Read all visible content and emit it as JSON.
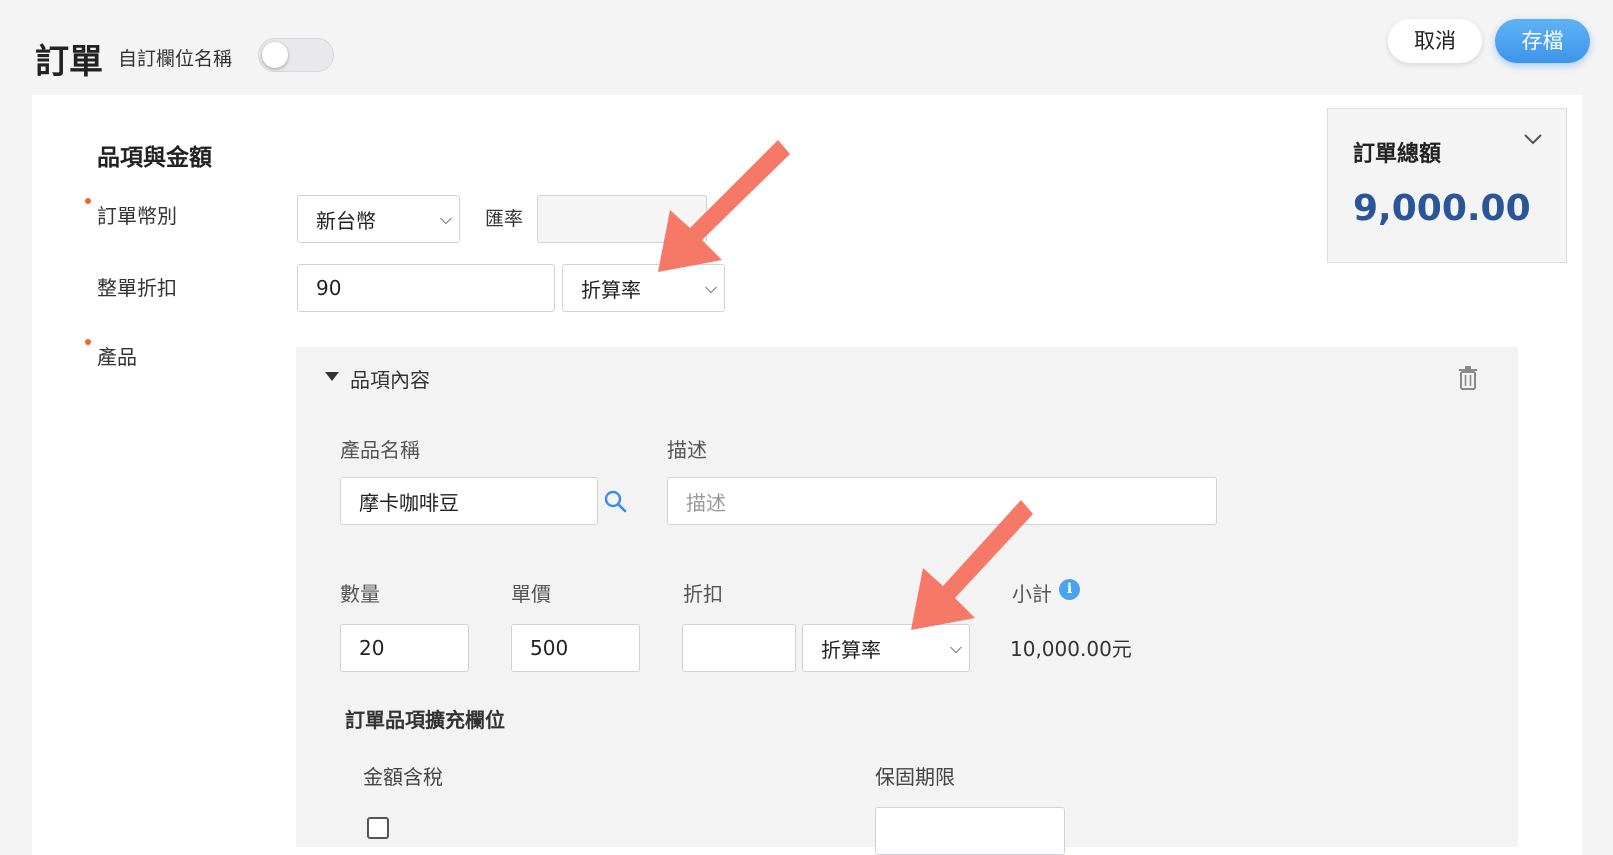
{
  "header": {
    "title": "訂單",
    "custom_label": "自訂欄位名稱",
    "toggle_on": false,
    "cancel_label": "取消",
    "save_label": "存檔"
  },
  "section": {
    "title": "品項與金額",
    "currency_label": "訂單幣別",
    "currency_value": "新台幣",
    "rate_label": "匯率",
    "rate_value": "",
    "discount_label": "整單折扣",
    "discount_value": "90",
    "discount_type": "折算率",
    "product_label": "產品"
  },
  "total": {
    "title": "訂單總額",
    "value": "9,000.00"
  },
  "item": {
    "collapse_label": "品項內容",
    "name_label": "產品名稱",
    "name_value": "摩卡咖啡豆",
    "desc_label": "描述",
    "desc_placeholder": "描述",
    "qty_label": "數量",
    "qty_value": "20",
    "price_label": "單價",
    "price_value": "500",
    "discount_label": "折扣",
    "discount_value": "",
    "discount_type": "折算率",
    "subtotal_label": "小計",
    "subtotal_value": "10,000.00元",
    "ext_title": "訂單品項擴充欄位",
    "tax_label": "金額含稅",
    "warranty_label": "保固期限"
  },
  "colors": {
    "accent": "#3d95ea",
    "total_value": "#2a5699",
    "required_dot": "#f0642d",
    "arrow": "#f5715f"
  },
  "icons": [
    "chevron-down-icon",
    "search-icon",
    "trash-icon",
    "info-icon",
    "caret-down-icon",
    "arrow-annotation"
  ]
}
